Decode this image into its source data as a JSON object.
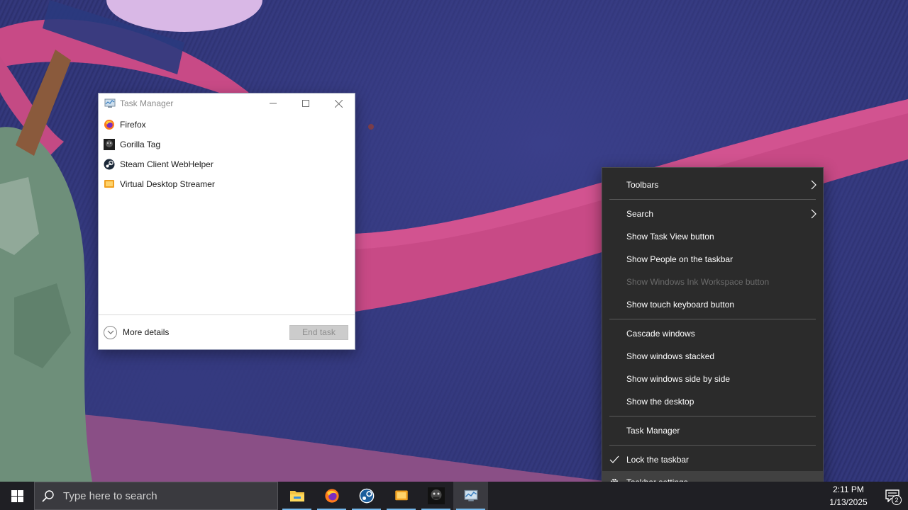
{
  "task_manager": {
    "title": "Task Manager",
    "apps": [
      {
        "name": "Firefox",
        "icon": "firefox-icon"
      },
      {
        "name": "Gorilla Tag",
        "icon": "gorilla-tag-icon"
      },
      {
        "name": "Steam Client WebHelper",
        "icon": "steam-icon"
      },
      {
        "name": "Virtual Desktop Streamer",
        "icon": "virtual-desktop-icon"
      }
    ],
    "more_details": "More details",
    "end_task": "End task"
  },
  "context_menu": {
    "items": [
      {
        "label": "Toolbars",
        "submenu": true
      },
      {
        "label": "Search",
        "submenu": true
      },
      {
        "label": "Show Task View button"
      },
      {
        "label": "Show People on the taskbar"
      },
      {
        "label": "Show Windows Ink Workspace button",
        "disabled": true
      },
      {
        "label": "Show touch keyboard button"
      },
      {
        "label": "Cascade windows"
      },
      {
        "label": "Show windows stacked"
      },
      {
        "label": "Show windows side by side"
      },
      {
        "label": "Show the desktop"
      },
      {
        "label": "Task Manager"
      },
      {
        "label": "Lock the taskbar",
        "checked": true
      },
      {
        "label": "Taskbar settings",
        "icon": "gear-icon",
        "highlighted": true
      }
    ]
  },
  "taskbar": {
    "search_placeholder": "Type here to search",
    "pinned": [
      {
        "icon": "file-explorer-icon",
        "running": true
      },
      {
        "icon": "firefox-icon",
        "running": true
      },
      {
        "icon": "steam-icon",
        "running": true
      },
      {
        "icon": "virtual-desktop-icon",
        "running": true
      },
      {
        "icon": "gorilla-tag-icon",
        "running": true
      },
      {
        "icon": "task-manager-icon",
        "running": true,
        "active": true
      }
    ],
    "clock_time": "2:11 PM",
    "clock_date": "1/13/2025",
    "notification_count": "2"
  },
  "colors": {
    "menu_bg": "#2b2b2b",
    "taskbar_bg": "#1f1f24",
    "accent": "#76b9ed"
  }
}
